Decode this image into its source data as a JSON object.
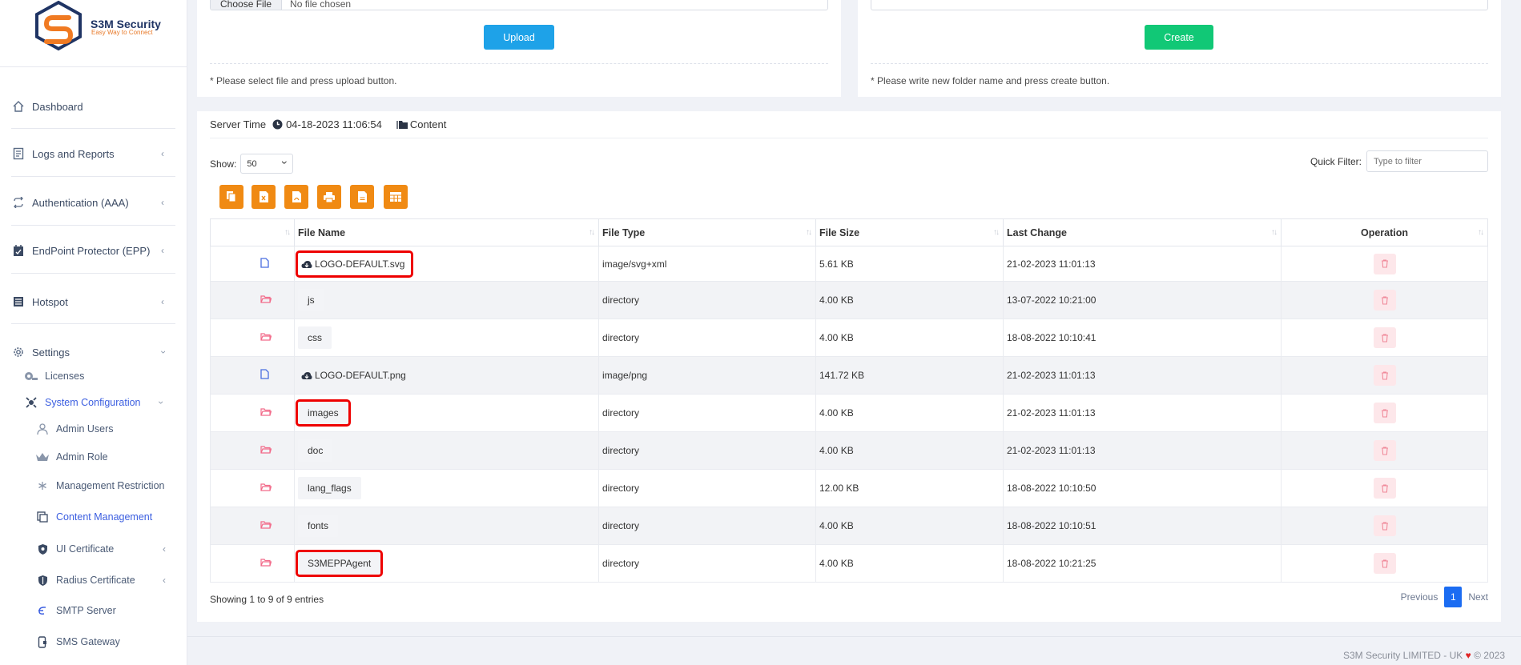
{
  "brand": {
    "name": "S3M Security",
    "tagline": "Easy Way to Connect"
  },
  "sidebar": {
    "items": [
      {
        "label": "Dashboard",
        "icon": "home-icon"
      },
      {
        "label": "Logs and Reports",
        "icon": "document-icon"
      },
      {
        "label": "Authentication (AAA)",
        "icon": "sync-icon"
      },
      {
        "label": "EndPoint Protector (EPP)",
        "icon": "calendar-check-icon"
      },
      {
        "label": "Hotspot",
        "icon": "list-icon"
      },
      {
        "label": "Settings",
        "icon": "gear-icon"
      }
    ],
    "settings_sub": [
      {
        "label": "Licenses",
        "icon": "license-icon"
      },
      {
        "label": "System Configuration",
        "icon": "config-icon"
      }
    ],
    "config_sub": [
      {
        "label": "Admin Users",
        "icon": "user-icon"
      },
      {
        "label": "Admin Role",
        "icon": "crown-icon"
      },
      {
        "label": "Management Restriction",
        "icon": "asterisk-icon"
      },
      {
        "label": "Content Management",
        "icon": "copy-icon"
      },
      {
        "label": "UI Certificate",
        "icon": "shield-icon"
      },
      {
        "label": "Radius Certificate",
        "icon": "shield-check-icon"
      },
      {
        "label": "SMTP Server",
        "icon": "mail-icon"
      },
      {
        "label": "SMS Gateway",
        "icon": "phone-icon"
      }
    ]
  },
  "upload_card": {
    "file_button": "Choose File",
    "file_value": "No file chosen",
    "button": "Upload",
    "note": "* Please select file and press upload button."
  },
  "folder_card": {
    "button": "Create",
    "note": "* Please write new folder name and press create button."
  },
  "toolbar": {
    "server_time_label": "Server Time",
    "server_time": "04-18-2023 11:06:54",
    "path": "Content"
  },
  "controls": {
    "show_label": "Show:",
    "show_value": "50",
    "quick_filter_label": "Quick Filter:",
    "quick_filter_placeholder": "Type to filter"
  },
  "export_buttons": [
    "copy-icon",
    "excel-icon",
    "pdf-icon",
    "print-icon",
    "csv-icon",
    "columns-icon"
  ],
  "table": {
    "headers": [
      "",
      "File Name",
      "File Type",
      "File Size",
      "Last Change",
      "Operation"
    ],
    "rows": [
      {
        "kind": "file",
        "name": "LOGO-DEFAULT.svg",
        "cloud": true,
        "type": "image/svg+xml",
        "size": "5.61 KB",
        "changed": "21-02-2023 11:01:13",
        "highlight": true
      },
      {
        "kind": "dir",
        "name": "js",
        "type": "directory",
        "size": "4.00 KB",
        "changed": "13-07-2022 10:21:00"
      },
      {
        "kind": "dir",
        "name": "css",
        "type": "directory",
        "size": "4.00 KB",
        "changed": "18-08-2022 10:10:41"
      },
      {
        "kind": "file",
        "name": "LOGO-DEFAULT.png",
        "cloud": true,
        "type": "image/png",
        "size": "141.72 KB",
        "changed": "21-02-2023 11:01:13"
      },
      {
        "kind": "dir",
        "name": "images",
        "type": "directory",
        "size": "4.00 KB",
        "changed": "21-02-2023 11:01:13",
        "highlight": true
      },
      {
        "kind": "dir",
        "name": "doc",
        "type": "directory",
        "size": "4.00 KB",
        "changed": "21-02-2023 11:01:13"
      },
      {
        "kind": "dir",
        "name": "lang_flags",
        "type": "directory",
        "size": "12.00 KB",
        "changed": "18-08-2022 10:10:50"
      },
      {
        "kind": "dir",
        "name": "fonts",
        "type": "directory",
        "size": "4.00 KB",
        "changed": "18-08-2022 10:10:51"
      },
      {
        "kind": "dir",
        "name": "S3MEPPAgent",
        "type": "directory",
        "size": "4.00 KB",
        "changed": "18-08-2022 10:21:25",
        "highlight": true
      }
    ]
  },
  "pagination": {
    "info": "Showing 1 to 9 of 9 entries",
    "previous": "Previous",
    "page": "1",
    "next": "Next"
  },
  "footer": {
    "text": "S3M Security LIMITED - UK",
    "year": "© 2023"
  },
  "colors": {
    "upload": "#1ea2e8",
    "create": "#11c876",
    "export": "#f08a13",
    "active_nav": "#3b5ee0",
    "highlight": "#e00000",
    "delete_icon": "#f08a9a"
  }
}
